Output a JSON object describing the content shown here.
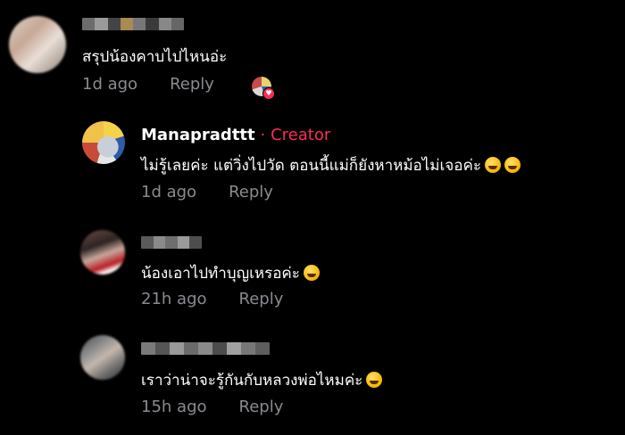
{
  "colors": {
    "background": "#000000",
    "text": "#ffffff",
    "meta": "#8a8b91",
    "creator_accent": "#fe2c55"
  },
  "comments": [
    {
      "text": "สรุปน้องคาบไปไหนอ่ะ",
      "time": "1d ago",
      "reply_label": "Reply",
      "liked_by_creator": true
    },
    {
      "name": "Manapradttt",
      "creator_label": "· Creator",
      "text": "ไม่รู้เลยค่ะ แต่วิ่งไปวัด ตอนนี้แม่ก็ยังหาหม้อไม่เจอค่ะ",
      "emoji": [
        "rolling-on-floor-laughing",
        "rolling-on-floor-laughing"
      ],
      "time": "1d ago",
      "reply_label": "Reply"
    },
    {
      "text": "น้องเอาไปทำบุญเหรอค่ะ",
      "emoji": [
        "grinning-sweat"
      ],
      "time": "21h ago",
      "reply_label": "Reply"
    },
    {
      "text": "เราว่าน่าจะรู้กันกับหลวงพ่อไหมค่ะ",
      "emoji": [
        "laughing-tears"
      ],
      "time": "15h ago",
      "reply_label": "Reply"
    }
  ]
}
